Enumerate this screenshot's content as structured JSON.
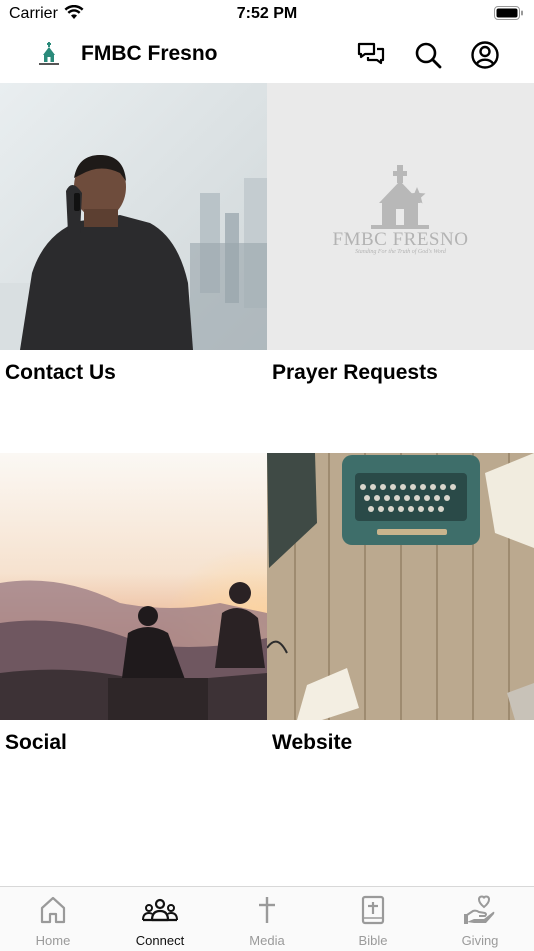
{
  "status_bar": {
    "carrier": "Carrier",
    "time": "7:52 PM"
  },
  "header": {
    "title": "FMBC Fresno",
    "icons": [
      "chat-icon",
      "search-icon",
      "account-icon"
    ]
  },
  "tiles": [
    {
      "label": "Contact Us"
    },
    {
      "label": "Prayer Requests",
      "logo_text": "FMBC FRESNO",
      "logo_tagline": "Standing For the Truth of God's Word"
    },
    {
      "label": "Social"
    },
    {
      "label": "Website"
    }
  ],
  "tabs": [
    {
      "label": "Home",
      "icon": "home-icon",
      "active": false
    },
    {
      "label": "Connect",
      "icon": "people-icon",
      "active": true
    },
    {
      "label": "Media",
      "icon": "cross-icon",
      "active": false
    },
    {
      "label": "Bible",
      "icon": "bible-icon",
      "active": false
    },
    {
      "label": "Giving",
      "icon": "giving-icon",
      "active": false
    }
  ],
  "colors": {
    "active": "#111111",
    "inactive": "#9a9a9a",
    "placeholder_bg": "#eaeaea"
  }
}
